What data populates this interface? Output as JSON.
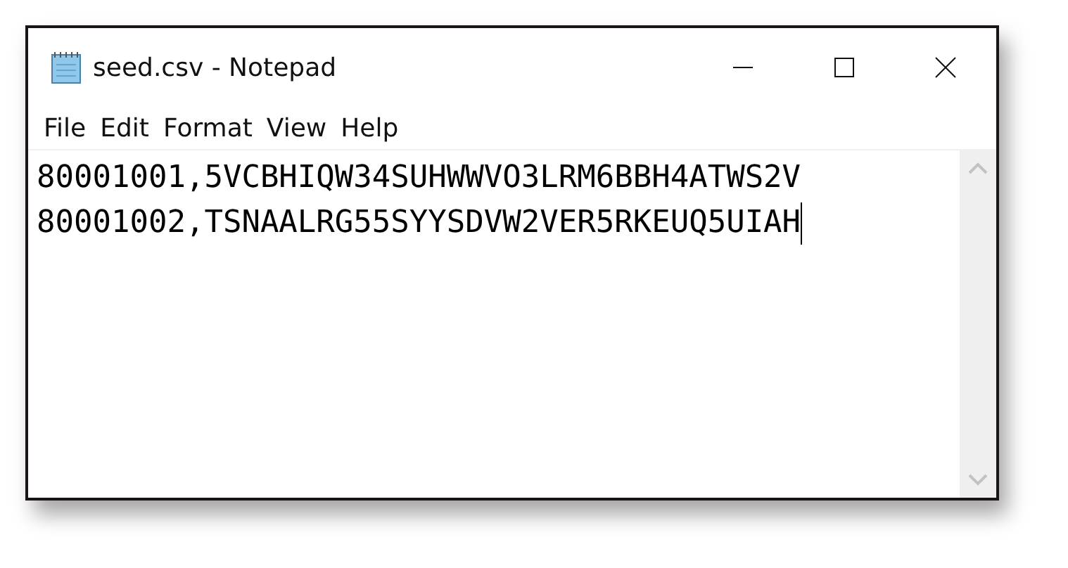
{
  "window": {
    "title": "seed.csv - Notepad"
  },
  "menu": [
    "File",
    "Edit",
    "Format",
    "View",
    "Help"
  ],
  "editor": {
    "lines": [
      "80001001,5VCBHIQW34SUHWWVO3LRM6BBH4ATWS2V",
      "80001002,TSNAALRG55SYYSDVW2VER5RKEUQ5UIAH"
    ]
  }
}
